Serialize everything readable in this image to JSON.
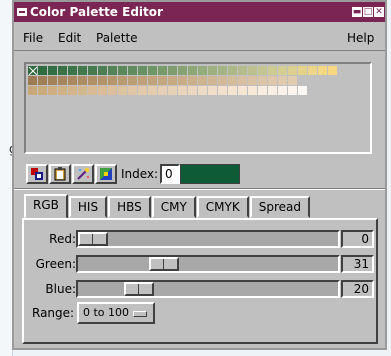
{
  "background": {
    "partial_text": "g"
  },
  "window": {
    "title": "Color Palette Editor",
    "controls": [
      "minimize",
      "maximize",
      "close"
    ]
  },
  "menu": {
    "file": "File",
    "edit": "Edit",
    "palette": "Palette",
    "help": "Help"
  },
  "palette": {
    "row1": [
      "#2e6b3f",
      "#2f6b40",
      "#346f44",
      "#387246",
      "#3c7549",
      "#41784c",
      "#467b4f",
      "#4c7f53",
      "#538357",
      "#5a885b",
      "#618c5f",
      "#689163",
      "#709567",
      "#779a6b",
      "#7f9e6f",
      "#86a373",
      "#8ea777",
      "#95ac7b",
      "#9db07f",
      "#a4b483",
      "#acb887",
      "#b4bc8b",
      "#bcc08e",
      "#c4c591",
      "#cccb93",
      "#d4cd94",
      "#dccf8f",
      "#e4d28b",
      "#ecd587",
      "#f3d884",
      "#f7d880"
    ],
    "row2": [
      "#9b7c55",
      "#a07f57",
      "#a4825a",
      "#a8865d",
      "#ab8960",
      "#af8d63",
      "#b29066",
      "#b5936a",
      "#b8966d",
      "#ba9a71",
      "#bd9d74",
      "#c0a078",
      "#c2a37b",
      "#c5a67f",
      "#c7aa83",
      "#caad87",
      "#ccb08b",
      "#ceb38f",
      "#d1b693",
      "#d3b997",
      "#d5bc9b",
      "#d8bf9f",
      "#dac2a3",
      "#dcc4a6",
      "#dec7aa",
      "#e0caad",
      "#e2ccb0"
    ],
    "row3": [
      "#c8a87a",
      "#cbab7e",
      "#ceae82",
      "#d0b186",
      "#d3b48b",
      "#d5b78f",
      "#d8ba94",
      "#dabd98",
      "#dcc09d",
      "#dec3a1",
      "#e0c6a6",
      "#e2c9aa",
      "#e4ccae",
      "#e6cfb3",
      "#e8d2b7",
      "#ead5bb",
      "#ecd8c0",
      "#eedbc4",
      "#f0dec8",
      "#f2e1cc",
      "#f4e4d0",
      "#f6e7d4",
      "#f7e9d7",
      "#f9ece0",
      "#faefe5",
      "#fbf2ea",
      "#fcf5ef",
      "#fdf8f4"
    ]
  },
  "toolbar": {
    "tools": [
      "paste-icon",
      "clipboard-icon",
      "sparkle-icon",
      "gradient-icon"
    ],
    "index_label": "Index:",
    "index_value": "0",
    "index_color": "#0e5c37"
  },
  "tabs": [
    "RGB",
    "HIS",
    "HBS",
    "CMY",
    "CMYK",
    "Spread"
  ],
  "active_tab": "RGB",
  "sliders": [
    {
      "label": "Red:",
      "value": "0",
      "level": 0
    },
    {
      "label": "Green:",
      "value": "31",
      "level": 31
    },
    {
      "label": "Blue:",
      "value": "20",
      "level": 20
    }
  ],
  "range": {
    "label": "Range:",
    "value": "0 to 100"
  }
}
